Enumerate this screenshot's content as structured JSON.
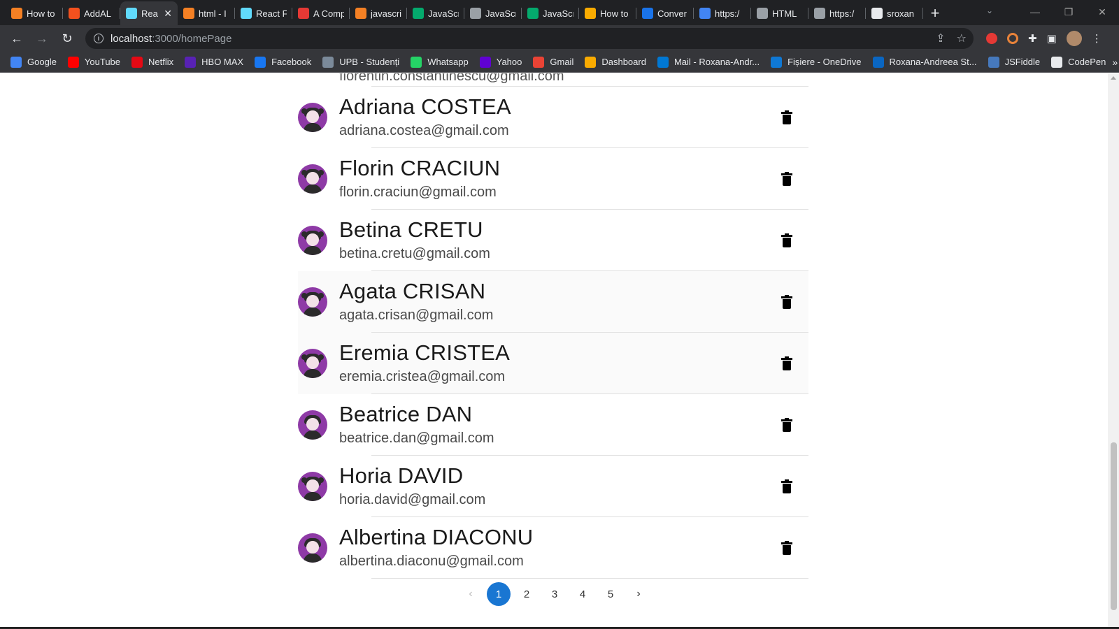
{
  "browser": {
    "tabs": [
      {
        "title": "How to",
        "icon": "stackoverflow-icon",
        "color": "#f48024"
      },
      {
        "title": "AddAL",
        "icon": "app-icon",
        "color": "#f4511e"
      },
      {
        "title": "Rea",
        "icon": "react-icon",
        "color": "#61dafb",
        "active": true
      },
      {
        "title": "html - I",
        "icon": "stackoverflow-icon",
        "color": "#f48024"
      },
      {
        "title": "React F",
        "icon": "react-icon",
        "color": "#61dafb"
      },
      {
        "title": "A Comp",
        "icon": "asterisk-icon",
        "color": "#e53935"
      },
      {
        "title": "javascri",
        "icon": "stackoverflow-icon",
        "color": "#f48024"
      },
      {
        "title": "JavaScr",
        "icon": "w3schools-icon",
        "color": "#04aa6d"
      },
      {
        "title": "JavaScr",
        "icon": "a-icon",
        "color": "#9aa0a6"
      },
      {
        "title": "JavaScr",
        "icon": "w3schools-icon",
        "color": "#04aa6d"
      },
      {
        "title": "How to",
        "icon": "shield-icon",
        "color": "#f9ab00"
      },
      {
        "title": "Conver",
        "icon": "j2c-icon",
        "color": "#1a73e8"
      },
      {
        "title": "https:/",
        "icon": "google-icon",
        "color": "#4285f4"
      },
      {
        "title": "HTML",
        "icon": "a-icon",
        "color": "#9aa0a6"
      },
      {
        "title": "https:/",
        "icon": "globe-icon",
        "color": "#9aa0a6"
      },
      {
        "title": "sroxan",
        "icon": "github-icon",
        "color": "#e8eaed"
      }
    ],
    "url_host": "localhost",
    "url_path": ":3000/homePage",
    "bookmarks": [
      {
        "label": "Google",
        "icon": "google-icon",
        "color": "#4285f4"
      },
      {
        "label": "YouTube",
        "icon": "youtube-icon",
        "color": "#ff0000"
      },
      {
        "label": "Netflix",
        "icon": "netflix-icon",
        "color": "#e50914"
      },
      {
        "label": "HBO MAX",
        "icon": "hbomax-icon",
        "color": "#5822b4"
      },
      {
        "label": "Facebook",
        "icon": "facebook-icon",
        "color": "#1877f2"
      },
      {
        "label": "UPB - Studenți",
        "icon": "upb-icon",
        "color": "#7b8a9a"
      },
      {
        "label": "Whatsapp",
        "icon": "whatsapp-icon",
        "color": "#25d366"
      },
      {
        "label": "Yahoo",
        "icon": "yahoo-icon",
        "color": "#6001d2"
      },
      {
        "label": "Gmail",
        "icon": "gmail-icon",
        "color": "#ea4335"
      },
      {
        "label": "Dashboard",
        "icon": "dashboard-icon",
        "color": "#f9ab00"
      },
      {
        "label": "Mail - Roxana-Andr...",
        "icon": "outlook-icon",
        "color": "#0078d4"
      },
      {
        "label": "Fișiere - OneDrive",
        "icon": "onedrive-icon",
        "color": "#0f78d4"
      },
      {
        "label": "Roxana-Andreea St...",
        "icon": "linkedin-icon",
        "color": "#0a66c2"
      },
      {
        "label": "JSFiddle",
        "icon": "jsfiddle-icon",
        "color": "#4679bd"
      },
      {
        "label": "CodePen",
        "icon": "codepen-icon",
        "color": "#e8eaed"
      }
    ],
    "bookmarks_more": "»"
  },
  "page": {
    "top_partial_email": "florentin.constantinescu@gmail.com",
    "contacts": [
      {
        "name": "Adriana COSTEA",
        "email": "adriana.costea@gmail.com",
        "avatar": "female"
      },
      {
        "name": "Florin CRACIUN",
        "email": "florin.craciun@gmail.com",
        "avatar": "female"
      },
      {
        "name": "Betina CRETU",
        "email": "betina.cretu@gmail.com",
        "avatar": "female"
      },
      {
        "name": "Agata CRISAN",
        "email": "agata.crisan@gmail.com",
        "avatar": "female",
        "highlighted": true
      },
      {
        "name": "Eremia CRISTEA",
        "email": "eremia.cristea@gmail.com",
        "avatar": "female",
        "highlighted": true
      },
      {
        "name": "Beatrice DAN",
        "email": "beatrice.dan@gmail.com",
        "avatar": "male"
      },
      {
        "name": "Horia DAVID",
        "email": "horia.david@gmail.com",
        "avatar": "female"
      },
      {
        "name": "Albertina DIACONU",
        "email": "albertina.diaconu@gmail.com",
        "avatar": "male"
      }
    ],
    "pagination": {
      "prev": "‹",
      "next": "›",
      "pages": [
        "1",
        "2",
        "3",
        "4",
        "5"
      ],
      "current": "1",
      "active_color": "#1976d2"
    }
  }
}
